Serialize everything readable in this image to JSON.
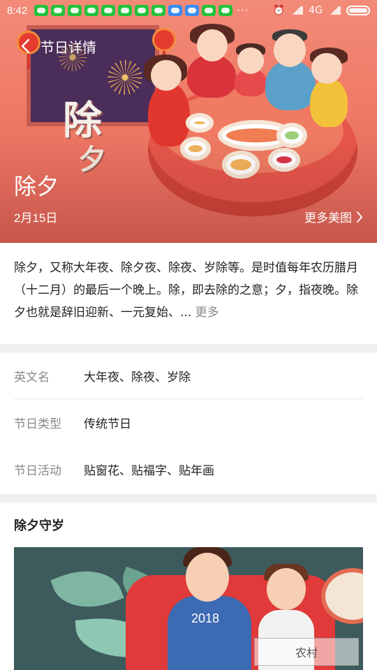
{
  "status_bar": {
    "time": "8:42",
    "network": "4G",
    "notification_icons": [
      "wechat-icon",
      "wechat-icon",
      "wechat-icon",
      "wechat-icon",
      "wechat-icon",
      "wechat-icon",
      "wechat-icon",
      "wechat-icon",
      "app-blue-icon",
      "app-blue-icon",
      "wechat-icon",
      "wechat-icon"
    ]
  },
  "nav": {
    "title": "节日详情"
  },
  "hero": {
    "art_text_1": "除",
    "art_text_2": "夕",
    "title": "除夕",
    "date": "2月15日",
    "more_pics": "更多美图"
  },
  "description": {
    "text": "除夕，又称大年夜、除夕夜、除夜、岁除等。是时值每年农历腊月（十二月）的最后一个晚上。除，即去除的之意；夕，指夜晚。除夕也就是辞旧迎新、一元复始、...",
    "more": "更多"
  },
  "info": {
    "rows": [
      {
        "label": "英文名",
        "value": "大年夜、除夜、岁除"
      },
      {
        "label": "节日类型",
        "value": "传统节日"
      },
      {
        "label": "节日活动",
        "value": "贴窗花、贴福字、贴年画"
      }
    ]
  },
  "section": {
    "title": "除夕守岁",
    "image_text": "2018",
    "watermark": "农村"
  },
  "colors": {
    "hero_start": "#f28b78",
    "hero_end": "#e5665a",
    "divider": "#f0f0f0",
    "label_gray": "#888888"
  }
}
